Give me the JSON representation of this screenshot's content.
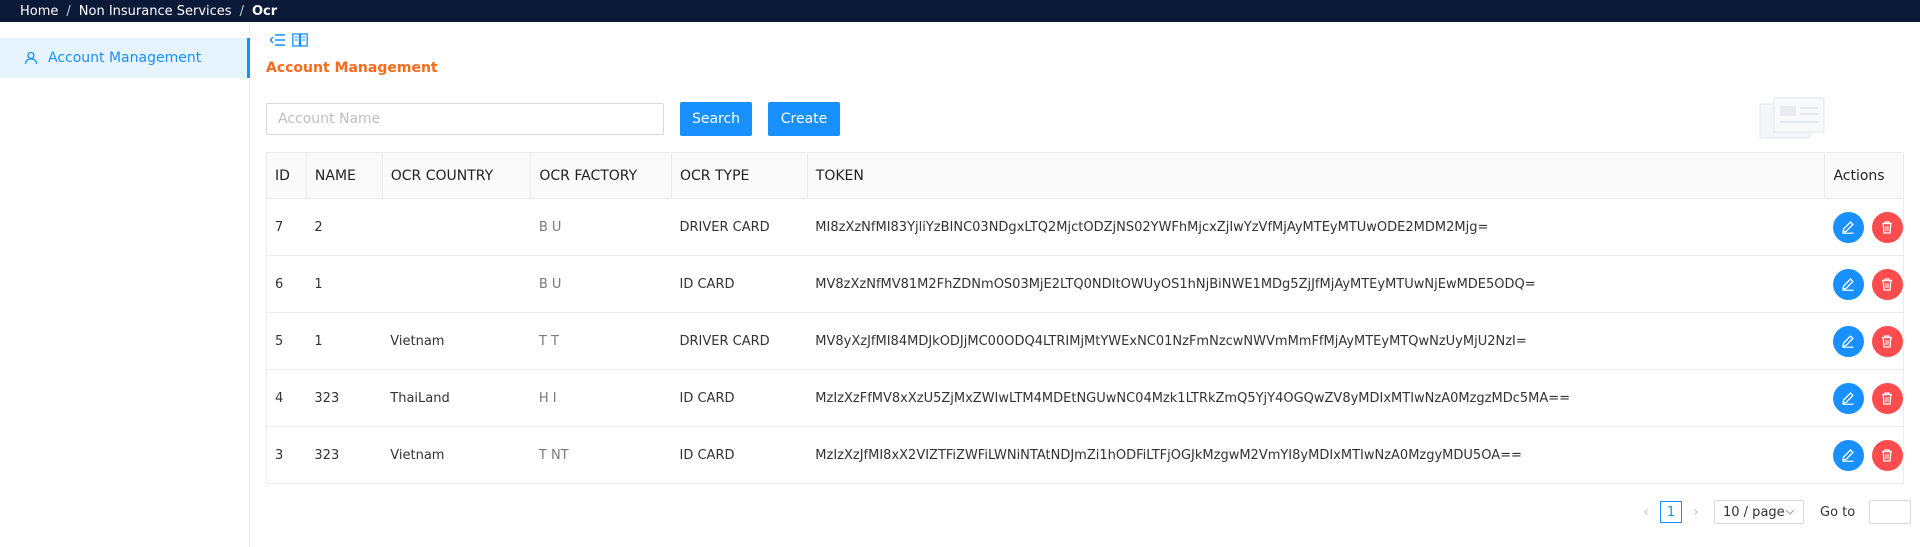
{
  "breadcrumb": [
    "Home",
    "Non Insurance Services",
    "Ocr"
  ],
  "sidebar": {
    "items": [
      {
        "label": "Account Management",
        "icon": "user-icon"
      }
    ]
  },
  "page": {
    "title": "Account Management"
  },
  "search": {
    "placeholder": "Account Name",
    "value": ""
  },
  "toolbar": {
    "search_label": "Search",
    "create_label": "Create"
  },
  "table": {
    "columns": [
      "ID",
      "NAME",
      "OCR COUNTRY",
      "OCR FACTORY",
      "OCR TYPE",
      "TOKEN",
      "Actions"
    ],
    "rows": [
      {
        "id": "7",
        "name": "2",
        "country": "",
        "factory": "B   U",
        "type": "DRIVER CARD",
        "token": "MI8zXzNfMI83YjliYzBINC03NDgxLTQ2MjctODZjNS02YWFhMjcxZjIwYzVfMjAyMTEyMTUwODE2MDM2Mjg="
      },
      {
        "id": "6",
        "name": "1",
        "country": "",
        "factory": "B   U",
        "type": "ID CARD",
        "token": "MV8zXzNfMV81M2FhZDNmOS03MjE2LTQ0NDItOWUyOS1hNjBiNWE1MDg5ZjJfMjAyMTEyMTUwNjEwMDE5ODQ="
      },
      {
        "id": "5",
        "name": "1",
        "country": "Vietnam",
        "factory": "T      T",
        "type": "DRIVER CARD",
        "token": "MV8yXzJfMI84MDJkODJjMC00ODQ4LTRIMjMtYWExNC01NzFmNzcwNWVmMmFfMjAyMTEyMTQwNzUyMjU2NzI="
      },
      {
        "id": "4",
        "name": "323",
        "country": "ThaiLand",
        "factory": "H      I",
        "type": "ID CARD",
        "token": "MzIzXzFfMV8xXzU5ZjMxZWIwLTM4MDEtNGUwNC04Mzk1LTRkZmQ5YjY4OGQwZV8yMDIxMTIwNzA0MzgzMDc5MA=="
      },
      {
        "id": "3",
        "name": "323",
        "country": "Vietnam",
        "factory": "T      NT",
        "type": "ID CARD",
        "token": "MzIzXzJfMI8xX2VIZTFiZWFiLWNiNTAtNDJmZi1hODFiLTFjOGJkMzgwM2VmYI8yMDIxMTIwNzA0MzgyMDU5OA=="
      }
    ]
  },
  "pagination": {
    "current": "1",
    "page_size": "10 / page",
    "goto_label": "Go to"
  },
  "colors": {
    "primary": "#1890ff",
    "danger": "#ff4d4f",
    "title": "#fa6a1c",
    "topbar": "#0c1a3a"
  }
}
